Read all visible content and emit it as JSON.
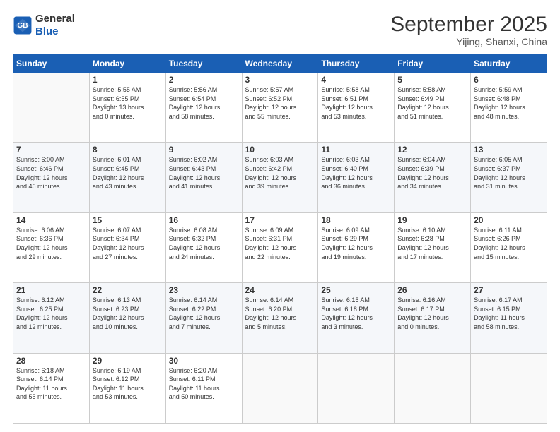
{
  "header": {
    "logo_line1": "General",
    "logo_line2": "Blue",
    "month_title": "September 2025",
    "location": "Yijing, Shanxi, China"
  },
  "weekdays": [
    "Sunday",
    "Monday",
    "Tuesday",
    "Wednesday",
    "Thursday",
    "Friday",
    "Saturday"
  ],
  "weeks": [
    [
      {
        "day": "",
        "sunrise": "",
        "sunset": "",
        "daylight": ""
      },
      {
        "day": "1",
        "sunrise": "Sunrise: 5:55 AM",
        "sunset": "Sunset: 6:55 PM",
        "daylight": "Daylight: 13 hours and 0 minutes."
      },
      {
        "day": "2",
        "sunrise": "Sunrise: 5:56 AM",
        "sunset": "Sunset: 6:54 PM",
        "daylight": "Daylight: 12 hours and 58 minutes."
      },
      {
        "day": "3",
        "sunrise": "Sunrise: 5:57 AM",
        "sunset": "Sunset: 6:52 PM",
        "daylight": "Daylight: 12 hours and 55 minutes."
      },
      {
        "day": "4",
        "sunrise": "Sunrise: 5:58 AM",
        "sunset": "Sunset: 6:51 PM",
        "daylight": "Daylight: 12 hours and 53 minutes."
      },
      {
        "day": "5",
        "sunrise": "Sunrise: 5:58 AM",
        "sunset": "Sunset: 6:49 PM",
        "daylight": "Daylight: 12 hours and 51 minutes."
      },
      {
        "day": "6",
        "sunrise": "Sunrise: 5:59 AM",
        "sunset": "Sunset: 6:48 PM",
        "daylight": "Daylight: 12 hours and 48 minutes."
      }
    ],
    [
      {
        "day": "7",
        "sunrise": "Sunrise: 6:00 AM",
        "sunset": "Sunset: 6:46 PM",
        "daylight": "Daylight: 12 hours and 46 minutes."
      },
      {
        "day": "8",
        "sunrise": "Sunrise: 6:01 AM",
        "sunset": "Sunset: 6:45 PM",
        "daylight": "Daylight: 12 hours and 43 minutes."
      },
      {
        "day": "9",
        "sunrise": "Sunrise: 6:02 AM",
        "sunset": "Sunset: 6:43 PM",
        "daylight": "Daylight: 12 hours and 41 minutes."
      },
      {
        "day": "10",
        "sunrise": "Sunrise: 6:03 AM",
        "sunset": "Sunset: 6:42 PM",
        "daylight": "Daylight: 12 hours and 39 minutes."
      },
      {
        "day": "11",
        "sunrise": "Sunrise: 6:03 AM",
        "sunset": "Sunset: 6:40 PM",
        "daylight": "Daylight: 12 hours and 36 minutes."
      },
      {
        "day": "12",
        "sunrise": "Sunrise: 6:04 AM",
        "sunset": "Sunset: 6:39 PM",
        "daylight": "Daylight: 12 hours and 34 minutes."
      },
      {
        "day": "13",
        "sunrise": "Sunrise: 6:05 AM",
        "sunset": "Sunset: 6:37 PM",
        "daylight": "Daylight: 12 hours and 31 minutes."
      }
    ],
    [
      {
        "day": "14",
        "sunrise": "Sunrise: 6:06 AM",
        "sunset": "Sunset: 6:36 PM",
        "daylight": "Daylight: 12 hours and 29 minutes."
      },
      {
        "day": "15",
        "sunrise": "Sunrise: 6:07 AM",
        "sunset": "Sunset: 6:34 PM",
        "daylight": "Daylight: 12 hours and 27 minutes."
      },
      {
        "day": "16",
        "sunrise": "Sunrise: 6:08 AM",
        "sunset": "Sunset: 6:32 PM",
        "daylight": "Daylight: 12 hours and 24 minutes."
      },
      {
        "day": "17",
        "sunrise": "Sunrise: 6:09 AM",
        "sunset": "Sunset: 6:31 PM",
        "daylight": "Daylight: 12 hours and 22 minutes."
      },
      {
        "day": "18",
        "sunrise": "Sunrise: 6:09 AM",
        "sunset": "Sunset: 6:29 PM",
        "daylight": "Daylight: 12 hours and 19 minutes."
      },
      {
        "day": "19",
        "sunrise": "Sunrise: 6:10 AM",
        "sunset": "Sunset: 6:28 PM",
        "daylight": "Daylight: 12 hours and 17 minutes."
      },
      {
        "day": "20",
        "sunrise": "Sunrise: 6:11 AM",
        "sunset": "Sunset: 6:26 PM",
        "daylight": "Daylight: 12 hours and 15 minutes."
      }
    ],
    [
      {
        "day": "21",
        "sunrise": "Sunrise: 6:12 AM",
        "sunset": "Sunset: 6:25 PM",
        "daylight": "Daylight: 12 hours and 12 minutes."
      },
      {
        "day": "22",
        "sunrise": "Sunrise: 6:13 AM",
        "sunset": "Sunset: 6:23 PM",
        "daylight": "Daylight: 12 hours and 10 minutes."
      },
      {
        "day": "23",
        "sunrise": "Sunrise: 6:14 AM",
        "sunset": "Sunset: 6:22 PM",
        "daylight": "Daylight: 12 hours and 7 minutes."
      },
      {
        "day": "24",
        "sunrise": "Sunrise: 6:14 AM",
        "sunset": "Sunset: 6:20 PM",
        "daylight": "Daylight: 12 hours and 5 minutes."
      },
      {
        "day": "25",
        "sunrise": "Sunrise: 6:15 AM",
        "sunset": "Sunset: 6:18 PM",
        "daylight": "Daylight: 12 hours and 3 minutes."
      },
      {
        "day": "26",
        "sunrise": "Sunrise: 6:16 AM",
        "sunset": "Sunset: 6:17 PM",
        "daylight": "Daylight: 12 hours and 0 minutes."
      },
      {
        "day": "27",
        "sunrise": "Sunrise: 6:17 AM",
        "sunset": "Sunset: 6:15 PM",
        "daylight": "Daylight: 11 hours and 58 minutes."
      }
    ],
    [
      {
        "day": "28",
        "sunrise": "Sunrise: 6:18 AM",
        "sunset": "Sunset: 6:14 PM",
        "daylight": "Daylight: 11 hours and 55 minutes."
      },
      {
        "day": "29",
        "sunrise": "Sunrise: 6:19 AM",
        "sunset": "Sunset: 6:12 PM",
        "daylight": "Daylight: 11 hours and 53 minutes."
      },
      {
        "day": "30",
        "sunrise": "Sunrise: 6:20 AM",
        "sunset": "Sunset: 6:11 PM",
        "daylight": "Daylight: 11 hours and 50 minutes."
      },
      {
        "day": "",
        "sunrise": "",
        "sunset": "",
        "daylight": ""
      },
      {
        "day": "",
        "sunrise": "",
        "sunset": "",
        "daylight": ""
      },
      {
        "day": "",
        "sunrise": "",
        "sunset": "",
        "daylight": ""
      },
      {
        "day": "",
        "sunrise": "",
        "sunset": "",
        "daylight": ""
      }
    ]
  ]
}
